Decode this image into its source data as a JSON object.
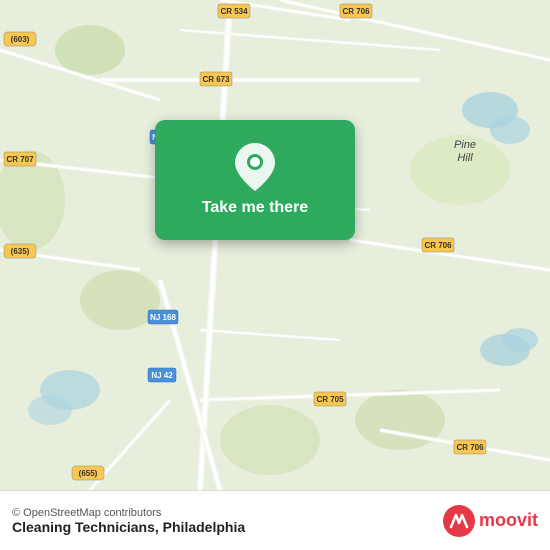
{
  "map": {
    "background_color": "#e8f0d8",
    "card": {
      "label": "Take me there",
      "pin_icon": "location-pin"
    }
  },
  "bottom_bar": {
    "copyright": "© OpenStreetMap contributors",
    "business_name": "Cleaning Technicians, Philadelphia",
    "moovit_label": "moovit"
  }
}
